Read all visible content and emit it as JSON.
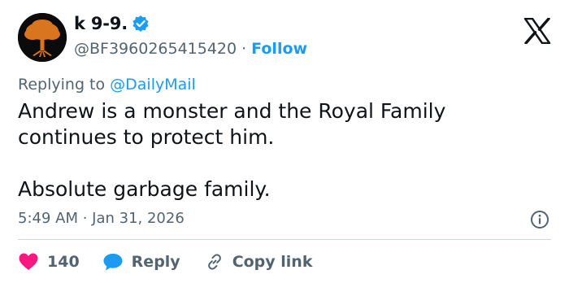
{
  "author": {
    "display_name": "k 9-9.",
    "handle": "@BF3960265415420",
    "separator": "·",
    "follow_label": "Follow"
  },
  "reply": {
    "prefix": "Replying to ",
    "target": "@DailyMail"
  },
  "tweet": {
    "line1": "Andrew is a monster and the Royal Family",
    "line2": "continues to protect him.",
    "line3": "Absolute garbage family."
  },
  "meta": {
    "time": "5:49 AM · Jan 31, 2026"
  },
  "actions": {
    "like_count": "140",
    "reply_label": "Reply",
    "copy_label": "Copy link"
  },
  "colors": {
    "accent": "#1d9bf0",
    "like": "#f91880",
    "secondary_text": "#536471"
  },
  "icons": {
    "avatar": "orange-tree-avatar",
    "verified": "verified-badge-icon",
    "logo": "x-logo-icon",
    "info": "info-icon",
    "like": "heart-icon",
    "reply": "reply-bubble-icon",
    "copy": "link-icon"
  }
}
